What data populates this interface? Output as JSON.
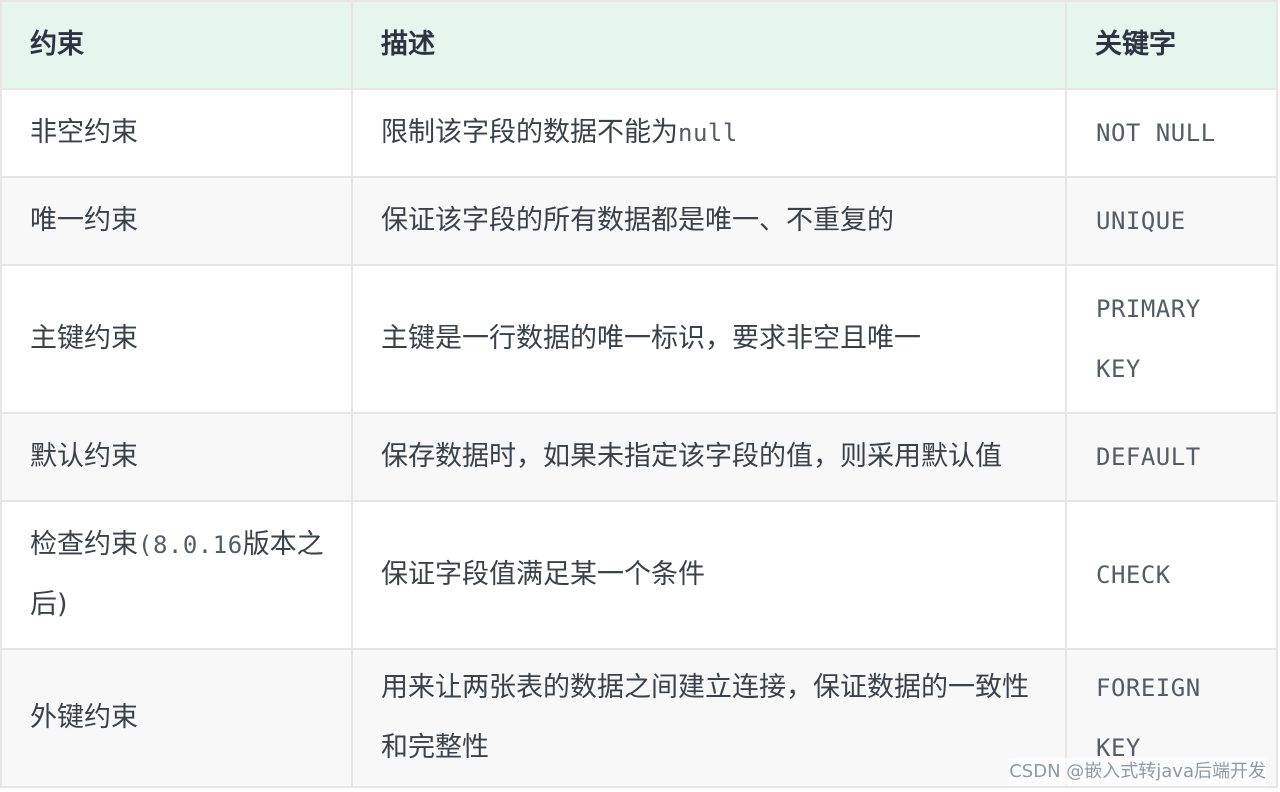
{
  "header": {
    "col1": "约束",
    "col2": "描述",
    "col3": "关键字"
  },
  "rows": [
    {
      "name": "非空约束",
      "desc": "限制该字段的数据不能为",
      "desc_code": "null",
      "keyword": "NOT NULL"
    },
    {
      "name": "唯一约束",
      "desc": "保证该字段的所有数据都是唯一、不重复的",
      "keyword": "UNIQUE"
    },
    {
      "name": "主键约束",
      "desc": "主键是一行数据的唯一标识，要求非空且唯一",
      "keyword": "PRIMARY KEY"
    },
    {
      "name": "默认约束",
      "desc": "保存数据时，如果未指定该字段的值，则采用默认值",
      "keyword": "DEFAULT"
    },
    {
      "name": "检查约束",
      "name_code": "(8.0.16",
      "name_suffix": "版本之后)",
      "desc": "保证字段值满足某一个条件",
      "keyword": "CHECK"
    },
    {
      "name": "外键约束",
      "desc": "用来让两张表的数据之间建立连接，保证数据的一致性和完整性",
      "keyword": "FOREIGN KEY"
    }
  ],
  "watermark": "CSDN @嵌入式转java后端开发"
}
